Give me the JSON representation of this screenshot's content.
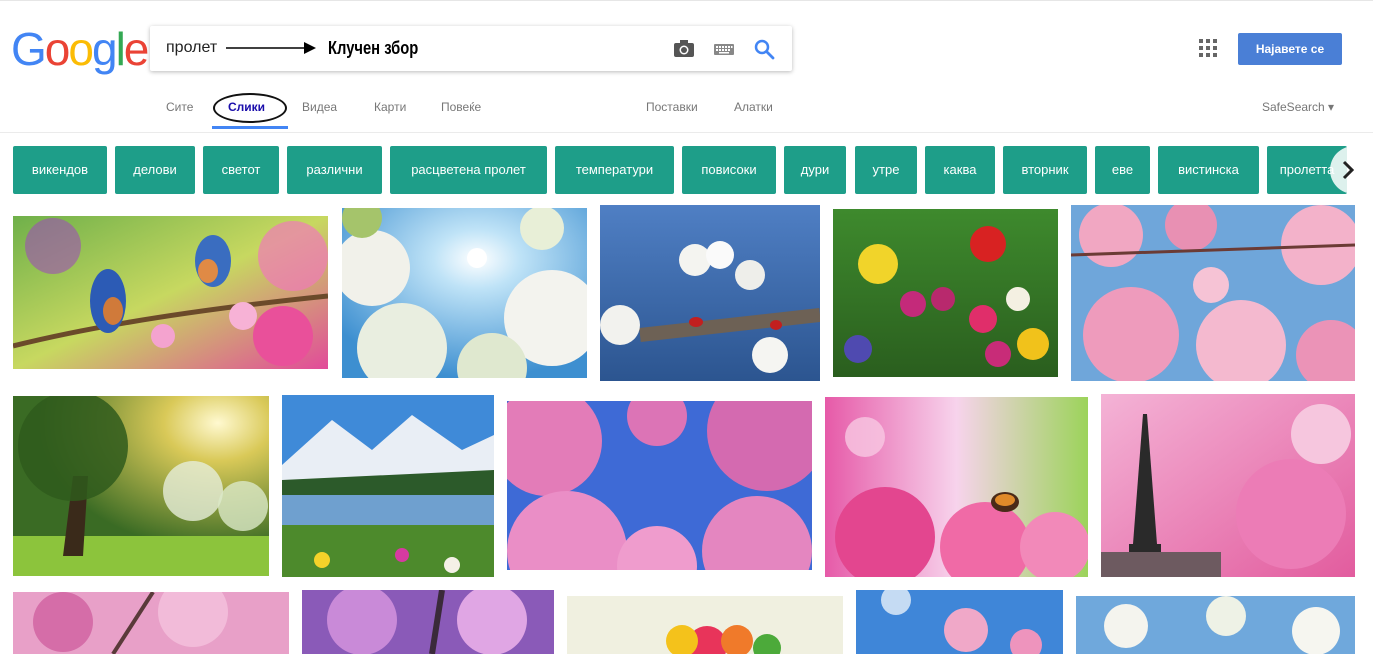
{
  "logo": {
    "letters": [
      "G",
      "o",
      "o",
      "g",
      "l",
      "e"
    ],
    "colors": [
      "#4285f4",
      "#ea4335",
      "#fbbc05",
      "#4285f4",
      "#34a853",
      "#ea4335"
    ]
  },
  "search": {
    "query": "пролет",
    "annotation": "Клучен збор",
    "icons": [
      "camera-icon",
      "keyboard-icon",
      "search-icon"
    ]
  },
  "header": {
    "signin_label": "Најавете се",
    "apps_icon": "apps-grid-icon"
  },
  "tabs": [
    {
      "label": "Сите"
    },
    {
      "label": "Слики",
      "active": true
    },
    {
      "label": "Видеа"
    },
    {
      "label": "Карти"
    },
    {
      "label": "Повеќе"
    }
  ],
  "tools": [
    {
      "label": "Поставки"
    },
    {
      "label": "Алатки"
    }
  ],
  "safesearch_label": "SafeSearch ▾",
  "chips": [
    "викендов",
    "делови",
    "светот",
    "различни",
    "расцветена пролет",
    "температури",
    "повисоки",
    "дури",
    "утре",
    "каква",
    "вторник",
    "еве",
    "вистинска",
    "пролетта"
  ],
  "colors": {
    "accent": "#4285f4",
    "chip_bg": "#1e9e89",
    "signin_bg": "#4a7fd6",
    "active_tab": "#1a0dab"
  },
  "images": [
    {
      "desc": "bluebirds on blossom branch"
    },
    {
      "desc": "white blossoms against sun"
    },
    {
      "desc": "ladybugs on cherry blossom"
    },
    {
      "desc": "tulips in meadow"
    },
    {
      "desc": "pink blossoms sky"
    },
    {
      "desc": "tree in sunny orchard"
    },
    {
      "desc": "mountain lake meadow"
    },
    {
      "desc": "pink tree canopy"
    },
    {
      "desc": "pink flowers with butterfly"
    },
    {
      "desc": "eiffel tower pink blossoms"
    },
    {
      "desc": "pink cherry trees"
    },
    {
      "desc": "purple blossom trees"
    },
    {
      "desc": "flower bouquet"
    },
    {
      "desc": "pink blossom blue sky"
    },
    {
      "desc": "white blossom blue sky"
    }
  ]
}
